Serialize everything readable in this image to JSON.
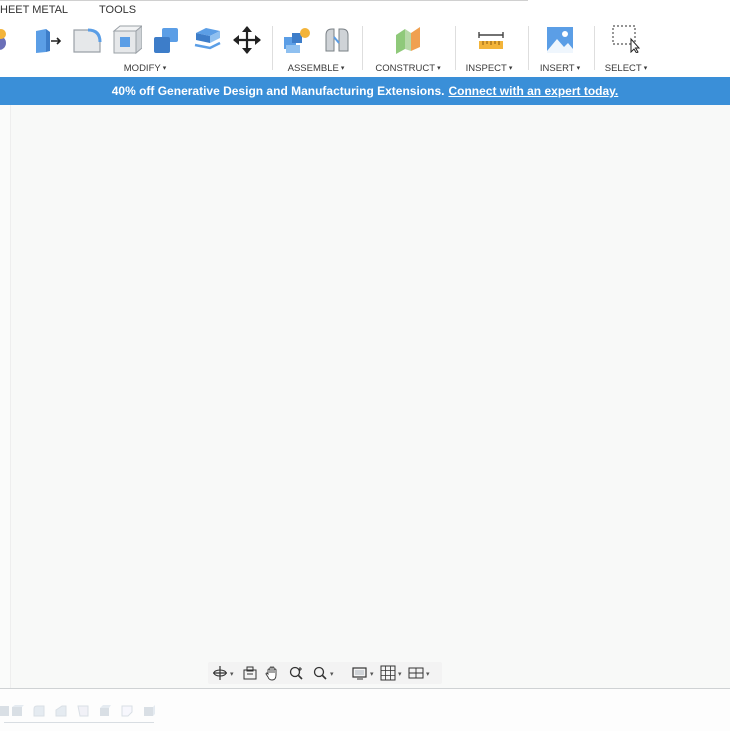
{
  "tabs": {
    "sheet_metal": "HEET METAL",
    "tools": "TOOLS"
  },
  "toolbar": {
    "groups": {
      "modify": "MODIFY",
      "assemble": "ASSEMBLE",
      "construct": "CONSTRUCT",
      "inspect": "INSPECT",
      "insert": "INSERT",
      "select": "SELECT"
    },
    "caret": "▾"
  },
  "banner": {
    "text": "40% off Generative Design and Manufacturing Extensions.",
    "link": "Connect with an expert today."
  },
  "colors": {
    "banner_bg": "#3a8fd8",
    "icon_blue": "#5b9ee6",
    "canvas_bg": "#f8f9f8"
  }
}
